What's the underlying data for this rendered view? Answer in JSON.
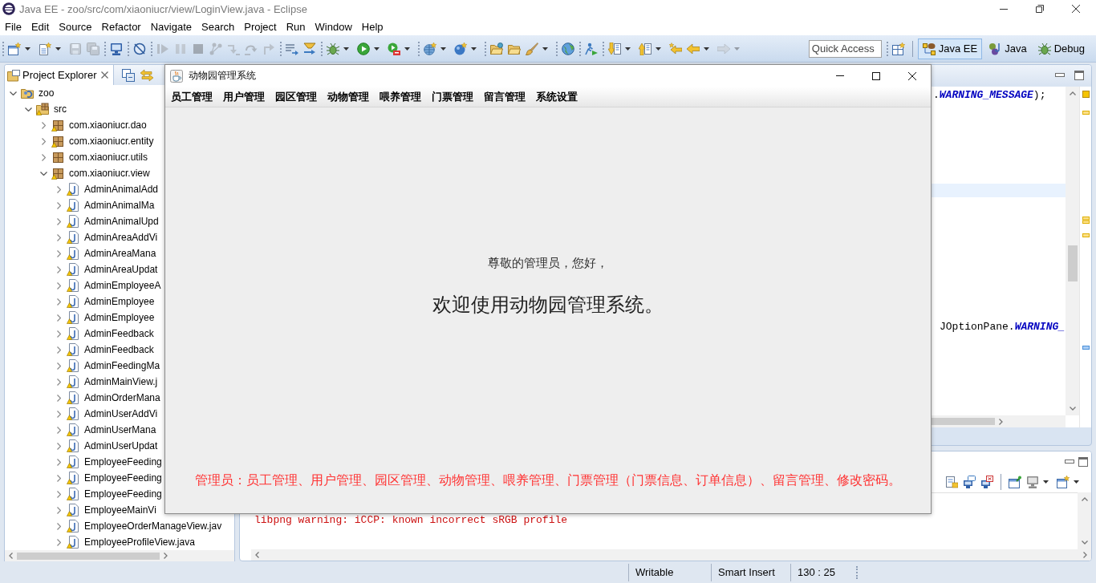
{
  "window": {
    "title": "Java EE - zoo/src/com/xiaoniucr/view/LoginView.java - Eclipse"
  },
  "menu": [
    "File",
    "Edit",
    "Source",
    "Refactor",
    "Navigate",
    "Search",
    "Project",
    "Run",
    "Window",
    "Help"
  ],
  "toolbar": {
    "groups": [
      [
        {
          "disabled": false,
          "dropdown": true
        },
        {
          "disabled": false,
          "dropdown": true
        },
        {
          "disabled": true,
          "dropdown": false
        },
        {
          "disabled": true,
          "dropdown": false
        }
      ],
      [
        {
          "disabled": false,
          "dropdown": false
        }
      ],
      [
        {
          "disabled": false,
          "dropdown": false
        }
      ],
      [
        {
          "disabled": true,
          "dropdown": false
        },
        {
          "disabled": true,
          "dropdown": false
        },
        {
          "disabled": true,
          "dropdown": false
        },
        {
          "disabled": true,
          "dropdown": false
        },
        {
          "disabled": true,
          "dropdown": false
        },
        {
          "disabled": true,
          "dropdown": false
        },
        {
          "disabled": true,
          "dropdown": false
        }
      ],
      [
        {
          "disabled": false,
          "dropdown": false
        },
        {
          "disabled": false,
          "dropdown": false
        }
      ],
      [
        {
          "disabled": false,
          "dropdown": true
        },
        {
          "disabled": false,
          "dropdown": true
        },
        {
          "disabled": false,
          "dropdown": true
        }
      ],
      [
        {
          "disabled": false,
          "dropdown": true
        },
        {
          "disabled": false,
          "dropdown": true
        }
      ],
      [
        {
          "disabled": false,
          "dropdown": false
        },
        {
          "disabled": false,
          "dropdown": false
        },
        {
          "disabled": false,
          "dropdown": true
        }
      ],
      [
        {
          "disabled": false,
          "dropdown": false
        }
      ],
      [
        {
          "disabled": false,
          "dropdown": false
        }
      ],
      [
        {
          "disabled": false,
          "dropdown": true
        },
        {
          "disabled": false,
          "dropdown": true
        },
        {
          "disabled": false,
          "dropdown": false
        },
        {
          "disabled": false,
          "dropdown": true
        },
        {
          "disabled": true,
          "dropdown": true
        }
      ]
    ]
  },
  "quick_access": {
    "placeholder": "Quick Access"
  },
  "perspectives": [
    {
      "label": "Java EE",
      "selected": true
    },
    {
      "label": "Java",
      "selected": false
    },
    {
      "label": "Debug",
      "selected": false
    }
  ],
  "project_explorer": {
    "title": "Project Explorer",
    "tree": [
      {
        "label": "zoo",
        "kind": "project",
        "expanded": true,
        "warning": false,
        "children": [
          {
            "label": "src",
            "kind": "source-folder",
            "expanded": true,
            "warning": true,
            "children": [
              {
                "label": "com.xiaoniucr.dao",
                "kind": "package",
                "expanded": false,
                "warning": true
              },
              {
                "label": "com.xiaoniucr.entity",
                "kind": "package",
                "expanded": false,
                "warning": true
              },
              {
                "label": "com.xiaoniucr.utils",
                "kind": "package",
                "expanded": false,
                "warning": false
              },
              {
                "label": "com.xiaoniucr.view",
                "kind": "package",
                "expanded": true,
                "warning": true,
                "children": [
                  {
                    "label": "AdminAnimalAdd",
                    "kind": "file",
                    "expanded": false,
                    "warning": true
                  },
                  {
                    "label": "AdminAnimalMa",
                    "kind": "file",
                    "expanded": false,
                    "warning": true
                  },
                  {
                    "label": "AdminAnimalUpd",
                    "kind": "file",
                    "expanded": false,
                    "warning": true
                  },
                  {
                    "label": "AdminAreaAddVi",
                    "kind": "file",
                    "expanded": false,
                    "warning": true
                  },
                  {
                    "label": "AdminAreaMana",
                    "kind": "file",
                    "expanded": false,
                    "warning": true
                  },
                  {
                    "label": "AdminAreaUpdat",
                    "kind": "file",
                    "expanded": false,
                    "warning": true
                  },
                  {
                    "label": "AdminEmployeeA",
                    "kind": "file",
                    "expanded": false,
                    "warning": true
                  },
                  {
                    "label": "AdminEmployee",
                    "kind": "file",
                    "expanded": false,
                    "warning": true
                  },
                  {
                    "label": "AdminEmployee",
                    "kind": "file",
                    "expanded": false,
                    "warning": true
                  },
                  {
                    "label": "AdminFeedback",
                    "kind": "file",
                    "expanded": false,
                    "warning": true
                  },
                  {
                    "label": "AdminFeedback",
                    "kind": "file",
                    "expanded": false,
                    "warning": true
                  },
                  {
                    "label": "AdminFeedingMa",
                    "kind": "file",
                    "expanded": false,
                    "warning": true
                  },
                  {
                    "label": "AdminMainView.j",
                    "kind": "file",
                    "expanded": false,
                    "warning": true
                  },
                  {
                    "label": "AdminOrderMana",
                    "kind": "file",
                    "expanded": false,
                    "warning": true
                  },
                  {
                    "label": "AdminUserAddVi",
                    "kind": "file",
                    "expanded": false,
                    "warning": true
                  },
                  {
                    "label": "AdminUserMana",
                    "kind": "file",
                    "expanded": false,
                    "warning": true
                  },
                  {
                    "label": "AdminUserUpdat",
                    "kind": "file",
                    "expanded": false,
                    "warning": true
                  },
                  {
                    "label": "EmployeeFeeding",
                    "kind": "file",
                    "expanded": false,
                    "warning": true
                  },
                  {
                    "label": "EmployeeFeeding",
                    "kind": "file",
                    "expanded": false,
                    "warning": true
                  },
                  {
                    "label": "EmployeeFeeding",
                    "kind": "file",
                    "expanded": false,
                    "warning": true
                  },
                  {
                    "label": "EmployeeMainVi",
                    "kind": "file",
                    "expanded": false,
                    "warning": true
                  },
                  {
                    "label": "EmployeeOrderManageView.jav",
                    "kind": "file",
                    "expanded": false,
                    "warning": true
                  },
                  {
                    "label": "EmployeeProfileView.java",
                    "kind": "file",
                    "expanded": false,
                    "warning": true
                  }
                ]
              }
            ]
          }
        ]
      }
    ]
  },
  "editor": {
    "lines": [
      {
        "current": false,
        "tokens": [
          {
            "text": ".",
            "kind": "plain"
          },
          {
            "text": "WARNING_MESSAGE",
            "kind": "constant"
          },
          {
            "text": ");",
            "kind": "plain"
          }
        ]
      },
      {
        "current": true
      },
      {
        "current": false,
        "tokens": [
          {
            "text": "JOptionPane.",
            "kind": "plain"
          },
          {
            "text": "WARNING_",
            "kind": "constant"
          }
        ]
      }
    ]
  },
  "console": {
    "lines": [
      {
        "text": "libpng warning: iCCP: known incorrect sRGB profile",
        "kind": "error"
      }
    ]
  },
  "status_bar": [
    "Writable",
    "Smart Insert",
    "130 : 25"
  ],
  "dialog": {
    "title": "动物园管理系统",
    "menu": [
      "员工管理",
      "用户管理",
      "园区管理",
      "动物管理",
      "喂养管理",
      "门票管理",
      "留言管理",
      "系统设置"
    ],
    "greeting": "尊敬的管理员，您好，",
    "welcome": "欢迎使用动物园管理系统。",
    "note": "管理员：员工管理、用户管理、园区管理、动物管理、喂养管理、门票管理（门票信息、订单信息）、留言管理、修改密码。"
  }
}
